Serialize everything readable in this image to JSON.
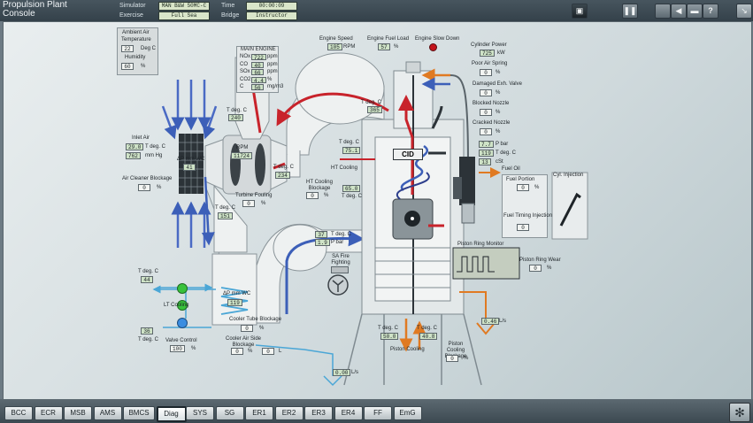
{
  "app": {
    "title_line1": "Propulsion Plant",
    "title_line2": "Console"
  },
  "header": {
    "simulator_label": "Simulator",
    "simulator_value": "MAN B&W 50MC-C",
    "time_label": "Time",
    "time_value": "00:00:09",
    "exercise_label": "Exercise",
    "exercise_value": "Full Sea",
    "bridge_label": "Bridge",
    "bridge_value": "Instructor"
  },
  "icons": {
    "monitor": "monitor-icon",
    "pause": "pause-icon",
    "speaker": "speaker-icon",
    "chat": "chat-icon",
    "help": "help-icon",
    "exit": "exit-icon",
    "fan": "fan-icon"
  },
  "ambient": {
    "title": "Ambient Air",
    "temp_label": "Temperature",
    "temp": "22",
    "temp_unit": "Deg C",
    "hum_label": "Humidity",
    "hum": "60",
    "hum_unit": "%"
  },
  "main_engine": {
    "title": "MAIN ENGINE",
    "rows": [
      {
        "k": "NOx",
        "v": "722",
        "u": "ppm"
      },
      {
        "k": "CO",
        "v": "40",
        "u": "ppm"
      },
      {
        "k": "SOx",
        "v": "66",
        "u": "ppm"
      },
      {
        "k": "CO2",
        "v": "4.4",
        "u": "%"
      },
      {
        "k": "C",
        "v": "56",
        "u": "mg/m3"
      }
    ]
  },
  "top": {
    "speed_label": "Engine Speed",
    "speed": "105",
    "speed_unit": "RPM",
    "load_label": "Engine Fuel Load",
    "load": "57",
    "load_unit": "%",
    "slow_label": "Engine Slow Down"
  },
  "cyl_power": {
    "label": "Cylinder Power",
    "value": "725",
    "unit": "kW"
  },
  "poor_air": {
    "label": "Poor Air Spring",
    "value": "0",
    "unit": "%"
  },
  "damaged_valve": {
    "label": "Damaged Exh. Valve",
    "value": "0",
    "unit": "%"
  },
  "blocked_nozzle": {
    "label": "Blocked Nozzle",
    "value": "0",
    "unit": "%"
  },
  "cracked_nozzle": {
    "label": "Cracked Nozzle",
    "value": "0",
    "unit": "%"
  },
  "fuel_readings": {
    "pbar": "7.7",
    "pbar_unit": "P bar",
    "tdeg": "119",
    "tdeg_unit": "T deg. C",
    "cst": "13",
    "cst_unit": "cSt"
  },
  "fuel_oil_label": "Fuel Oil",
  "fuel_portion": {
    "label": "Fuel Portion",
    "value": "0",
    "unit": "%"
  },
  "fuel_timing": {
    "label": "Fuel Timing Injection",
    "value": "0"
  },
  "cyl_injection": {
    "label": "Cyl. Injection"
  },
  "exhaust_t": {
    "label": "T deg. C",
    "value": "365"
  },
  "turbine_in_t": {
    "label": "T deg. C",
    "value": "240"
  },
  "turbine_out_t": {
    "label": "T deg. C",
    "value": "234"
  },
  "turbo": {
    "rpm_label": "RPM",
    "rpm": "11724",
    "dp_label": "ΔP mm WC",
    "dp": "41"
  },
  "inlet_air": {
    "label": "Inlet Air",
    "t": "29.0",
    "t_unit": "T deg. C",
    "p": "762",
    "p_unit": "mm Hg"
  },
  "air_cleaner": {
    "label": "Air Cleaner Blockage",
    "value": "0",
    "unit": "%"
  },
  "turbine_fouling": {
    "label": "Turbine Fouling",
    "value": "0",
    "unit": "%"
  },
  "compressor_t": {
    "label": "T deg. C",
    "value": "151"
  },
  "ht_cooling": {
    "t_label": "T deg. C",
    "t": "75.1",
    "label": "HT Cooling",
    "blockage_label": "HT Cooling Blockage",
    "blockage": "0",
    "unit": "%",
    "out": "65.0",
    "out_unit": "T deg. C"
  },
  "cid_label": "CID",
  "scav_air": {
    "t": "37",
    "t_unit": "T deg. C",
    "p": "1.9",
    "p_unit": "P bar"
  },
  "fire_fighting": {
    "label": "SA Fire Fighting"
  },
  "piston_ring_monitor": {
    "label": "Piston Ring Monitor"
  },
  "piston_ring_wear": {
    "label": "Piston Ring Wear",
    "value": "0",
    "unit": "%"
  },
  "lt": {
    "t_label": "T deg. C",
    "t": "44",
    "label": "LT Cooling",
    "t2": "36",
    "t2_label": "T deg. C"
  },
  "valve_control": {
    "label": "Valve Control",
    "value": "100",
    "unit": "%"
  },
  "cooler_air_dp": {
    "label": "ΔP mm WC",
    "value": "119"
  },
  "cooler_tube": {
    "label": "Cooler Tube Blockage",
    "value": "0",
    "unit": "%"
  },
  "cooler_air_side": {
    "label": "Cooler Air Side Blockage",
    "value": "0",
    "unit": "%",
    "value2": "0",
    "unit2": "L"
  },
  "drain_flow": {
    "value": "0.00",
    "unit": "L/s"
  },
  "piston_cooling": {
    "t1_label": "T deg. C",
    "t1": "50.0",
    "t2_label": "T deg. C",
    "t2": "40.8",
    "label": "Piston Cooling",
    "blockage_label": "Piston Cooling Blockage",
    "blockage": "0",
    "unit": "%"
  },
  "lo_flow": {
    "value": "0.46",
    "unit": "L/s"
  },
  "taskbar": {
    "tabs": [
      "BCC",
      "ECR",
      "MSB",
      "AMS",
      "BMCS",
      "Diag",
      "SYS",
      "SG",
      "ER1",
      "ER2",
      "ER3",
      "ER4",
      "FF",
      "EmG"
    ],
    "active": "Diag"
  }
}
